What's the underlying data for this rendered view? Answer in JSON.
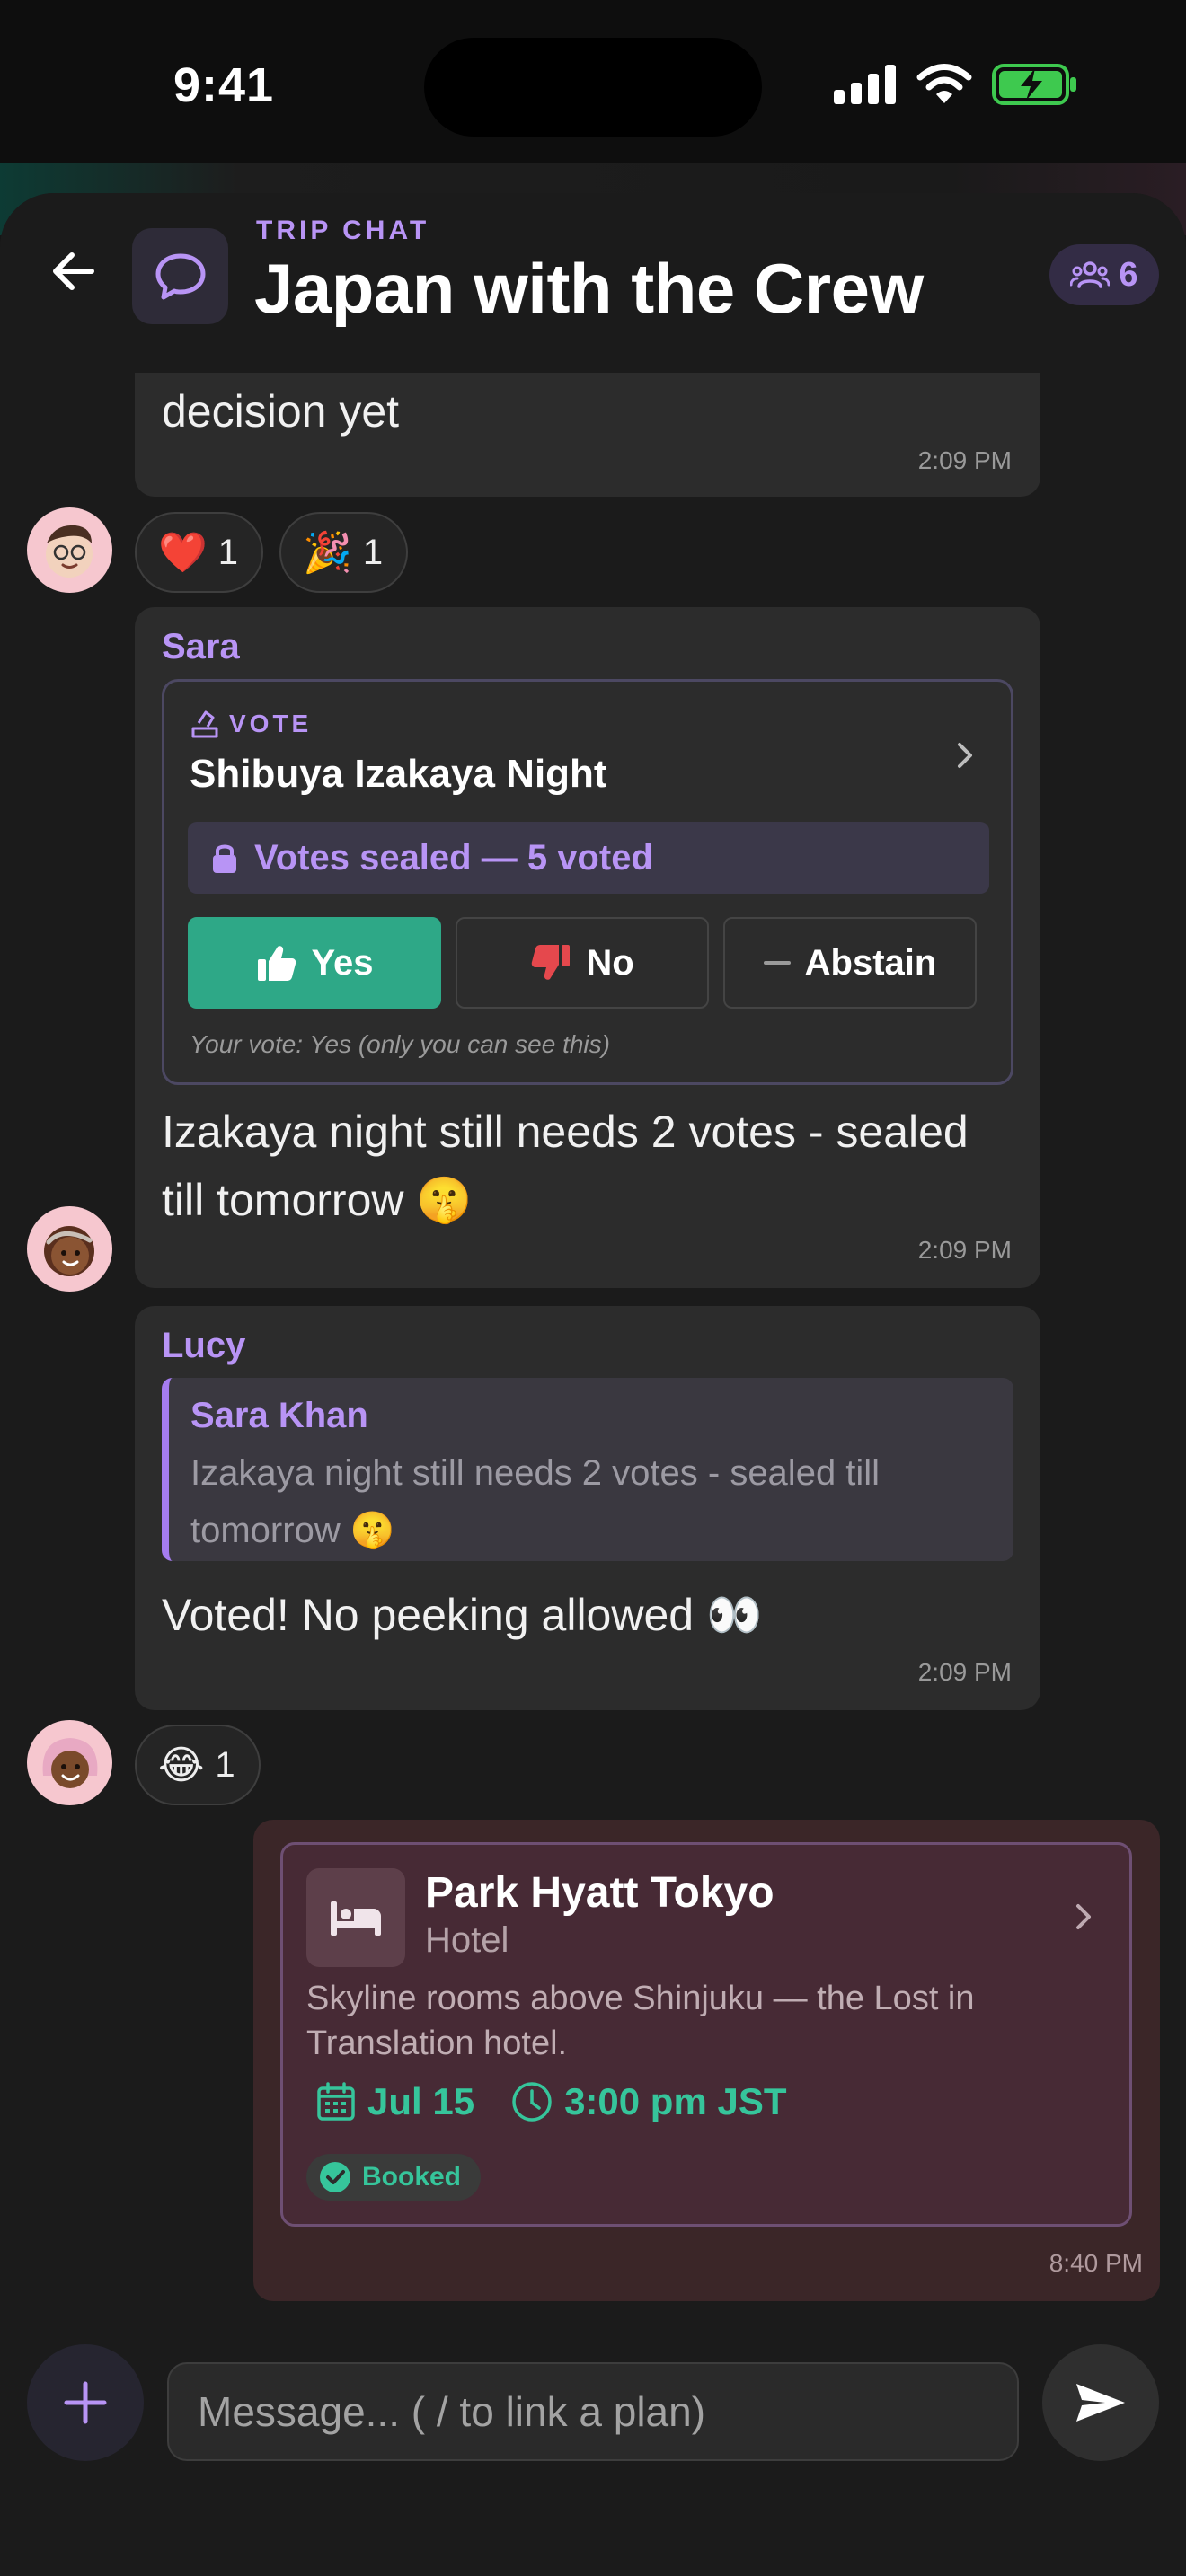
{
  "status_bar": {
    "time": "9:41",
    "icons": [
      "cellular-signal-icon",
      "wifi-icon",
      "battery-charging-icon"
    ]
  },
  "header": {
    "eyebrow": "TRIP CHAT",
    "title": "Japan with the Crew",
    "member_count": "6",
    "icons": {
      "back": "arrow-left-icon",
      "chat": "chat-bubble-icon",
      "members": "group-icon"
    }
  },
  "colors": {
    "accent": "#b894f5",
    "green": "#2ea887",
    "own_bubble": "#3b2628",
    "background": "#1b1b1b"
  },
  "messages": [
    {
      "id": "m1",
      "text": "decision yet",
      "time": "2:09 PM",
      "reactions": [
        {
          "emoji": "❤️",
          "count": "1"
        },
        {
          "emoji": "🎉",
          "count": "1"
        }
      ]
    },
    {
      "id": "m2",
      "sender": "Sara",
      "vote": {
        "label": "VOTE",
        "title": "Shibuya Izakaya Night",
        "sealed_text": "Votes sealed — 5 voted",
        "options": [
          {
            "label": "Yes",
            "icon": "thumbs-up-icon",
            "selected": true
          },
          {
            "label": "No",
            "icon": "thumbs-down-icon",
            "selected": false
          },
          {
            "label": "Abstain",
            "icon": "minus-icon",
            "selected": false
          }
        ],
        "your_vote": "Your vote: Yes (only you can see this)"
      },
      "text": "Izakaya night still needs 2 votes - sealed till tomorrow 🤫",
      "time": "2:09 PM"
    },
    {
      "id": "m3",
      "sender": "Lucy",
      "reply_to": {
        "name": "Sara Khan",
        "text": "Izakaya night still needs 2 votes - sealed till tomorrow 🤫"
      },
      "text": "Voted! No peeking allowed 👀",
      "time": "2:09 PM",
      "reactions": [
        {
          "emoji": "😂",
          "count": "1"
        }
      ]
    },
    {
      "id": "m4",
      "own": true,
      "plan": {
        "name": "Park Hyatt Tokyo",
        "type": "Hotel",
        "description": "Skyline rooms above Shinjuku — the Lost in Translation hotel.",
        "date": "Jul 15",
        "time": "3:00 pm JST",
        "status": "Booked",
        "icon": "bed-icon"
      },
      "time": "8:40 PM"
    }
  ],
  "composer": {
    "placeholder": "Message... ( / to link a plan)",
    "value": ""
  }
}
